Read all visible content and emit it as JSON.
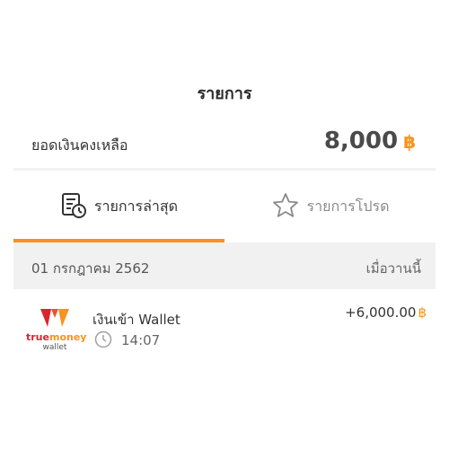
{
  "header": {
    "title": "รายการ"
  },
  "balance": {
    "label": "ยอดเงินคงเหลือ",
    "amount": "8,000",
    "currency": "฿"
  },
  "tabs": [
    {
      "label": "รายการล่าสุด",
      "icon": "list-clock-icon",
      "active": true
    },
    {
      "label": "รายการโปรด",
      "icon": "star-icon",
      "active": false
    }
  ],
  "date_group": {
    "date": "01 กรกฎาคม 2562",
    "relative": "เมื่อวานนี้"
  },
  "transactions": [
    {
      "title": "เงินเข้า Wallet",
      "time": "14:07",
      "amount": "+6,000.00",
      "currency": "฿",
      "logo": {
        "brand_true": "true",
        "brand_money": "money",
        "sub": "wallet"
      }
    }
  ],
  "colors": {
    "accent": "#f7931e",
    "brand_red": "#d9262c"
  }
}
